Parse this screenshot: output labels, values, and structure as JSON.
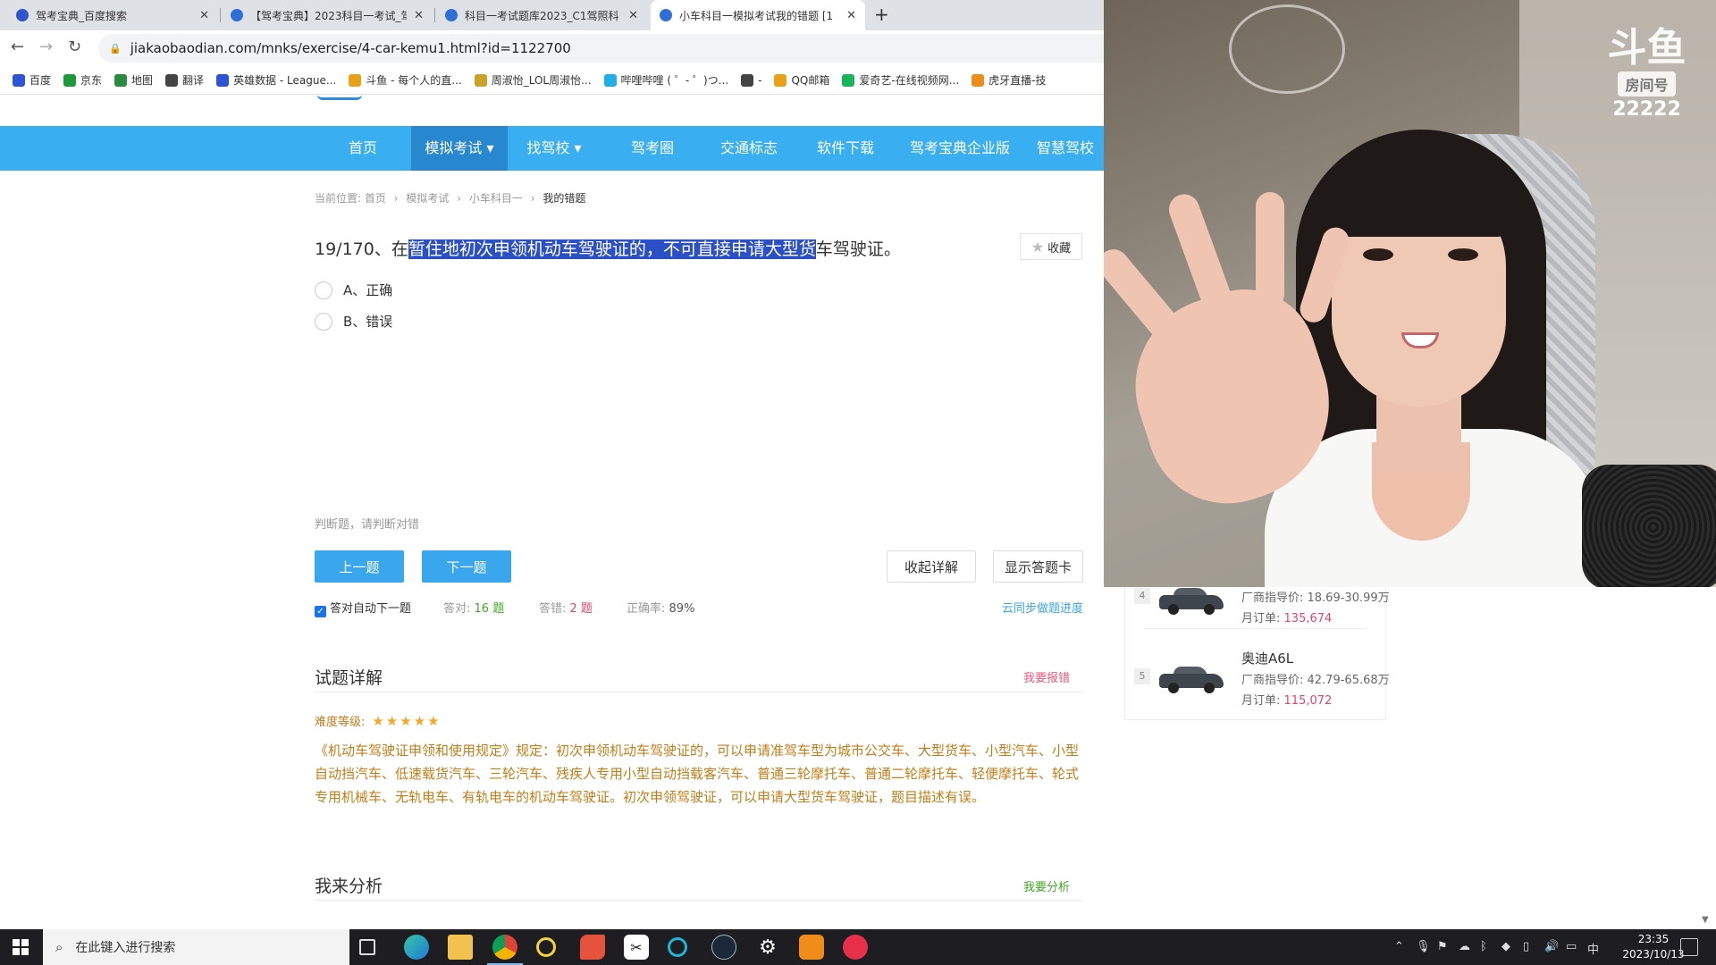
{
  "browser": {
    "tabs": [
      {
        "title": "驾考宝典_百度搜索"
      },
      {
        "title": "【驾考宝典】2023科目一考试_驾"
      },
      {
        "title": "科目一考试题库2023_C1驾照科"
      },
      {
        "title": "小车科目一模拟考试我的错题 [1"
      }
    ],
    "tab_close": "✕",
    "new_tab": "+",
    "url": "jiakaobaodian.com/mnks/exercise/4-car-kemu1.html?id=1122700",
    "bookmarks": [
      {
        "label": "百度",
        "color": "#2f55d4"
      },
      {
        "label": "京东",
        "color": "#1d9b3a"
      },
      {
        "label": "地图",
        "color": "#2b8a3e"
      },
      {
        "label": "翻译",
        "color": "#444444"
      },
      {
        "label": "英雄数据 - League...",
        "color": "#2f55d4"
      },
      {
        "label": "斗鱼 - 每个人的直...",
        "color": "#e8a21a"
      },
      {
        "label": "周淑怡_LOL周淑怡...",
        "color": "#c9a227"
      },
      {
        "label": "哔哩哔哩 ( ゜- ゜)つ...",
        "color": "#23ade5"
      },
      {
        "label": "-",
        "color": "#444444"
      },
      {
        "label": "QQ邮箱",
        "color": "#e8a21a"
      },
      {
        "label": "爱奇艺-在线视频网...",
        "color": "#17b35d"
      },
      {
        "label": "虎牙直播-技",
        "color": "#f08d1a"
      }
    ]
  },
  "site_nav": {
    "items": [
      "首页",
      "模拟考试",
      "找驾校",
      "驾考圈",
      "交通标志",
      "软件下载",
      "驾考宝典企业版",
      "智慧驾校"
    ],
    "dropdown_caret": "▾"
  },
  "breadcrumb": {
    "prefix": "当前位置:",
    "items": [
      "首页",
      "模拟考试",
      "小车科目一"
    ],
    "current": "我的错题",
    "sep": "›"
  },
  "question": {
    "number": "19/170、在",
    "highlighted": "暂住地初次申领机动车驾驶证的，不可直接申请大型货",
    "rest": "车驾驶证。",
    "favorite_label": "收藏",
    "options": [
      "A、正确",
      "B、错误"
    ],
    "hint": "判断题，请判断对错"
  },
  "buttons": {
    "prev": "上一题",
    "next": "下一题",
    "collapse": "收起详解",
    "answer_card": "显示答题卡"
  },
  "stats": {
    "auto_next": "答对自动下一题",
    "correct_label": "答对:",
    "correct_value": "16 题",
    "wrong_label": "答错:",
    "wrong_value": "2 题",
    "accuracy_label": "正确率:",
    "accuracy_value": "89%",
    "sync_link": "云同步做题进度"
  },
  "detail": {
    "title": "试题详解",
    "report_link": "我要报错",
    "difficulty_label": "难度等级:",
    "stars": "★★★★★",
    "difficulty_level": 5,
    "text": "《机动车驾驶证申领和使用规定》规定：初次申领机动车驾驶证的，可以申请准驾车型为城市公交车、大型货车、小型汽车、小型自动挡汽车、低速载货汽车、三轮汽车、残疾人专用小型自动挡载客汽车、普通三轮摩托车、普通二轮摩托车、轻便摩托车、轮式专用机械车、无轨电车、有轨电车的机动车驾驶证。初次申领驾驶证，可以申请大型货车驾驶证，题目描述有误。"
  },
  "analysis": {
    "title": "我来分析",
    "link": "我要分析"
  },
  "ranking": [
    {
      "rank": "4",
      "name": "",
      "price": "厂商指导价: 18.69-30.99万",
      "orders_label": "月订单:",
      "orders": "135,674"
    },
    {
      "rank": "5",
      "name": "奥迪A6L",
      "price": "厂商指导价: 42.79-65.68万",
      "orders_label": "月订单:",
      "orders": "115,072"
    }
  ],
  "stream_overlay": {
    "logo": "斗鱼",
    "room_label": "房间号",
    "room_number": "22222"
  },
  "taskbar": {
    "search_placeholder": "在此键入进行搜索",
    "ime": "中",
    "time": "23:35",
    "date": "2023/10/13"
  }
}
